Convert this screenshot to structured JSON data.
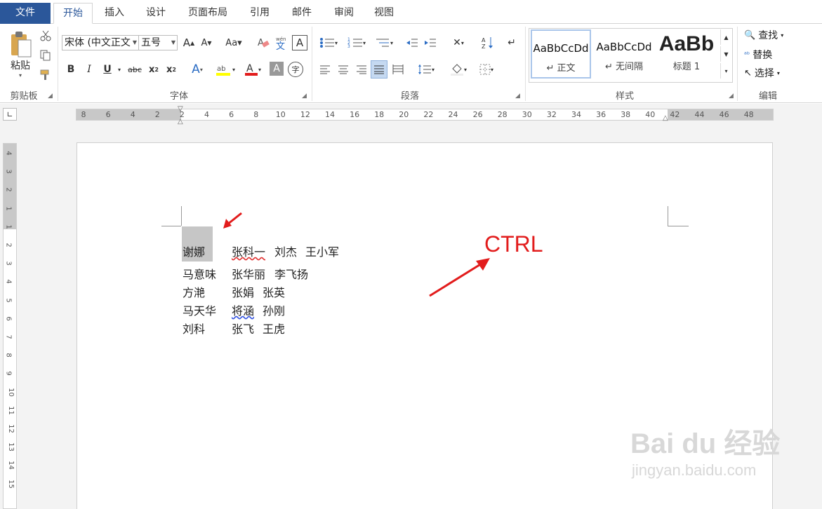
{
  "tabs": [
    "文件",
    "开始",
    "插入",
    "设计",
    "页面布局",
    "引用",
    "邮件",
    "审阅",
    "视图"
  ],
  "clipboard": {
    "paste_label": "粘贴",
    "group_label": "剪贴板"
  },
  "font": {
    "family_value": "宋体 (中文正文",
    "size_value": "五号",
    "group_label": "字体"
  },
  "paragraph": {
    "group_label": "段落"
  },
  "styles": {
    "items": [
      {
        "sample": "AaBbCcDd",
        "name": "↵ 正文"
      },
      {
        "sample": "AaBbCcDd",
        "name": "↵ 无间隔"
      },
      {
        "sample": "AaBb",
        "name": "标题 1"
      }
    ],
    "group_label": "样式"
  },
  "editing": {
    "find": "查找",
    "replace": "替换",
    "select": "选择",
    "group_label": "编辑"
  },
  "ruler": {
    "h_labels": [
      "8",
      "6",
      "4",
      "2",
      "2",
      "4",
      "6",
      "8",
      "10",
      "12",
      "14",
      "16",
      "18",
      "20",
      "22",
      "24",
      "26",
      "28",
      "30",
      "32",
      "34",
      "36",
      "38",
      "40",
      "42",
      "44",
      "46",
      "48"
    ],
    "v_labels": [
      "4",
      "3",
      "2",
      "1",
      "1",
      "2",
      "3",
      "4",
      "5",
      "6",
      "7",
      "8",
      "9",
      "10",
      "11",
      "12",
      "13",
      "14",
      "15"
    ]
  },
  "document": {
    "rows": [
      [
        "谢娜",
        "张科一",
        "刘杰",
        "王小军"
      ],
      [
        "马意味",
        "张华丽",
        "李飞扬"
      ],
      [
        "方滟",
        "张娟",
        "张英"
      ],
      [
        "马天华",
        "将涵",
        "孙刚"
      ],
      [
        "刘科",
        "张飞",
        "王虎"
      ]
    ]
  },
  "annotation": {
    "text": "CTRL",
    "color": "#e21c1c"
  },
  "watermark": {
    "brand": "Bai du 经验",
    "url": "jingyan.baidu.com"
  }
}
